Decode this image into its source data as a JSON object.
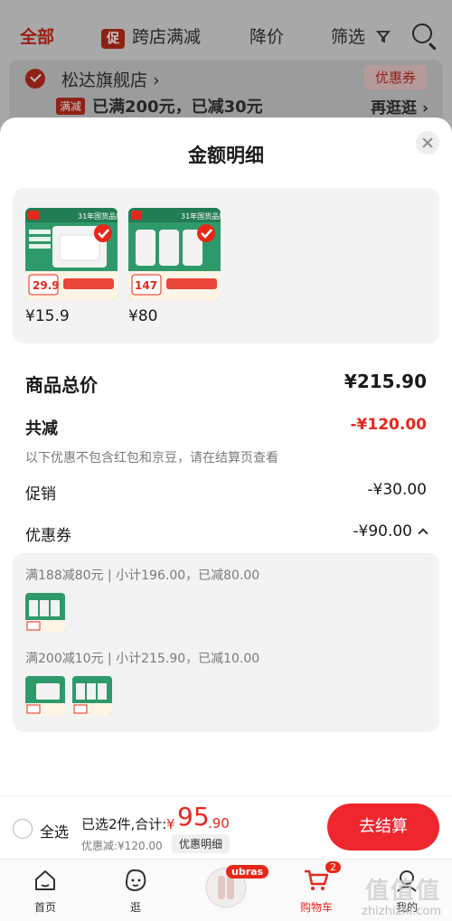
{
  "background": {
    "tabs": [
      {
        "label": "全部"
      },
      {
        "tag": "促",
        "label": "跨店满减"
      },
      {
        "label": "降价"
      },
      {
        "label": "筛选"
      }
    ],
    "shop": {
      "name": "松达旗舰店 ›",
      "coupon_label": "优惠券",
      "full_tag": "满减",
      "full_text": "已满200元，已减30元",
      "browse_label": "再逛逛 ›"
    }
  },
  "sheet": {
    "title": "金额明细",
    "products": [
      {
        "price": "¥15.9",
        "img_label": "29.9",
        "img_top": "31年国货品牌"
      },
      {
        "price": "¥80",
        "img_label": "147",
        "img_top": "31年国货品牌"
      }
    ],
    "total": {
      "label": "商品总价",
      "value": "¥215.90"
    },
    "reduce": {
      "label": "共减",
      "value": "-¥120.00"
    },
    "note": "以下优惠不包含红包和京豆，请在结算页查看",
    "promo": {
      "label": "促销",
      "value": "-¥30.00"
    },
    "coupon": {
      "label": "优惠券",
      "value": "-¥90.00"
    },
    "coupon_details": [
      {
        "text": "满188减80元 | 小计196.00，已减80.00"
      },
      {
        "text": "满200减10元 | 小计215.90，已减10.00"
      }
    ]
  },
  "checkout": {
    "select_all": "全选",
    "selected": "已选2件,合计:",
    "yen": "¥",
    "amount_int": "95",
    "amount_dec": ".90",
    "discount": "优惠减:¥120.00",
    "detail_label": "优惠明细",
    "pay_label": "去结算"
  },
  "tabbar": {
    "items": [
      {
        "label": "首页"
      },
      {
        "label": "逛"
      },
      {
        "label": ""
      },
      {
        "label": "购物车"
      },
      {
        "label": "我的"
      }
    ],
    "ubras": "ubras",
    "cart_badge": "2"
  },
  "watermark": {
    "main": "值值值",
    "sub": "zhizhizhi.com"
  },
  "colors": {
    "accent": "#f0262f",
    "price_red": "#e8271b",
    "brand_green": "#2e9a6a"
  }
}
